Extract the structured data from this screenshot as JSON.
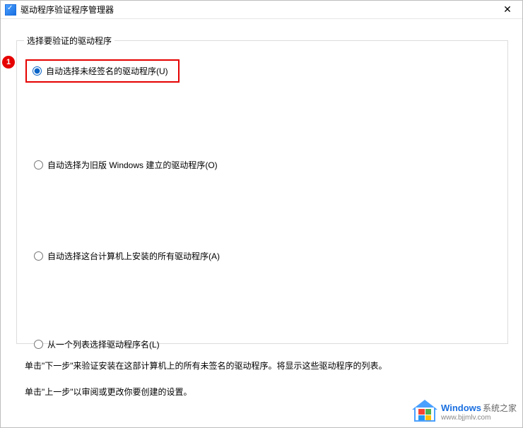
{
  "window": {
    "title": "驱动程序验证程序管理器",
    "close_glyph": "✕"
  },
  "step_badge": "1",
  "group": {
    "label": "选择要验证的驱动程序",
    "options": [
      {
        "id": "opt-unsigned",
        "label": "自动选择未经签名的驱动程序(U)",
        "selected": true,
        "highlighted": true
      },
      {
        "id": "opt-oldwin",
        "label": "自动选择为旧版 Windows 建立的驱动程序(O)",
        "selected": false,
        "highlighted": false
      },
      {
        "id": "opt-all",
        "label": "自动选择这台计算机上安装的所有驱动程序(A)",
        "selected": false,
        "highlighted": false
      },
      {
        "id": "opt-list",
        "label": "从一个列表选择驱动程序名(L)",
        "selected": false,
        "highlighted": false
      }
    ]
  },
  "hints": {
    "line1": "单击\"下一步\"来验证安装在这部计算机上的所有未签名的驱动程序。将显示这些驱动程序的列表。",
    "line2": "单击\"上一步\"以审阅或更改你要创建的设置。"
  },
  "watermark": {
    "brand": "Windows",
    "brand_cn": "系统之家",
    "url": "www.bjjmlv.com"
  }
}
